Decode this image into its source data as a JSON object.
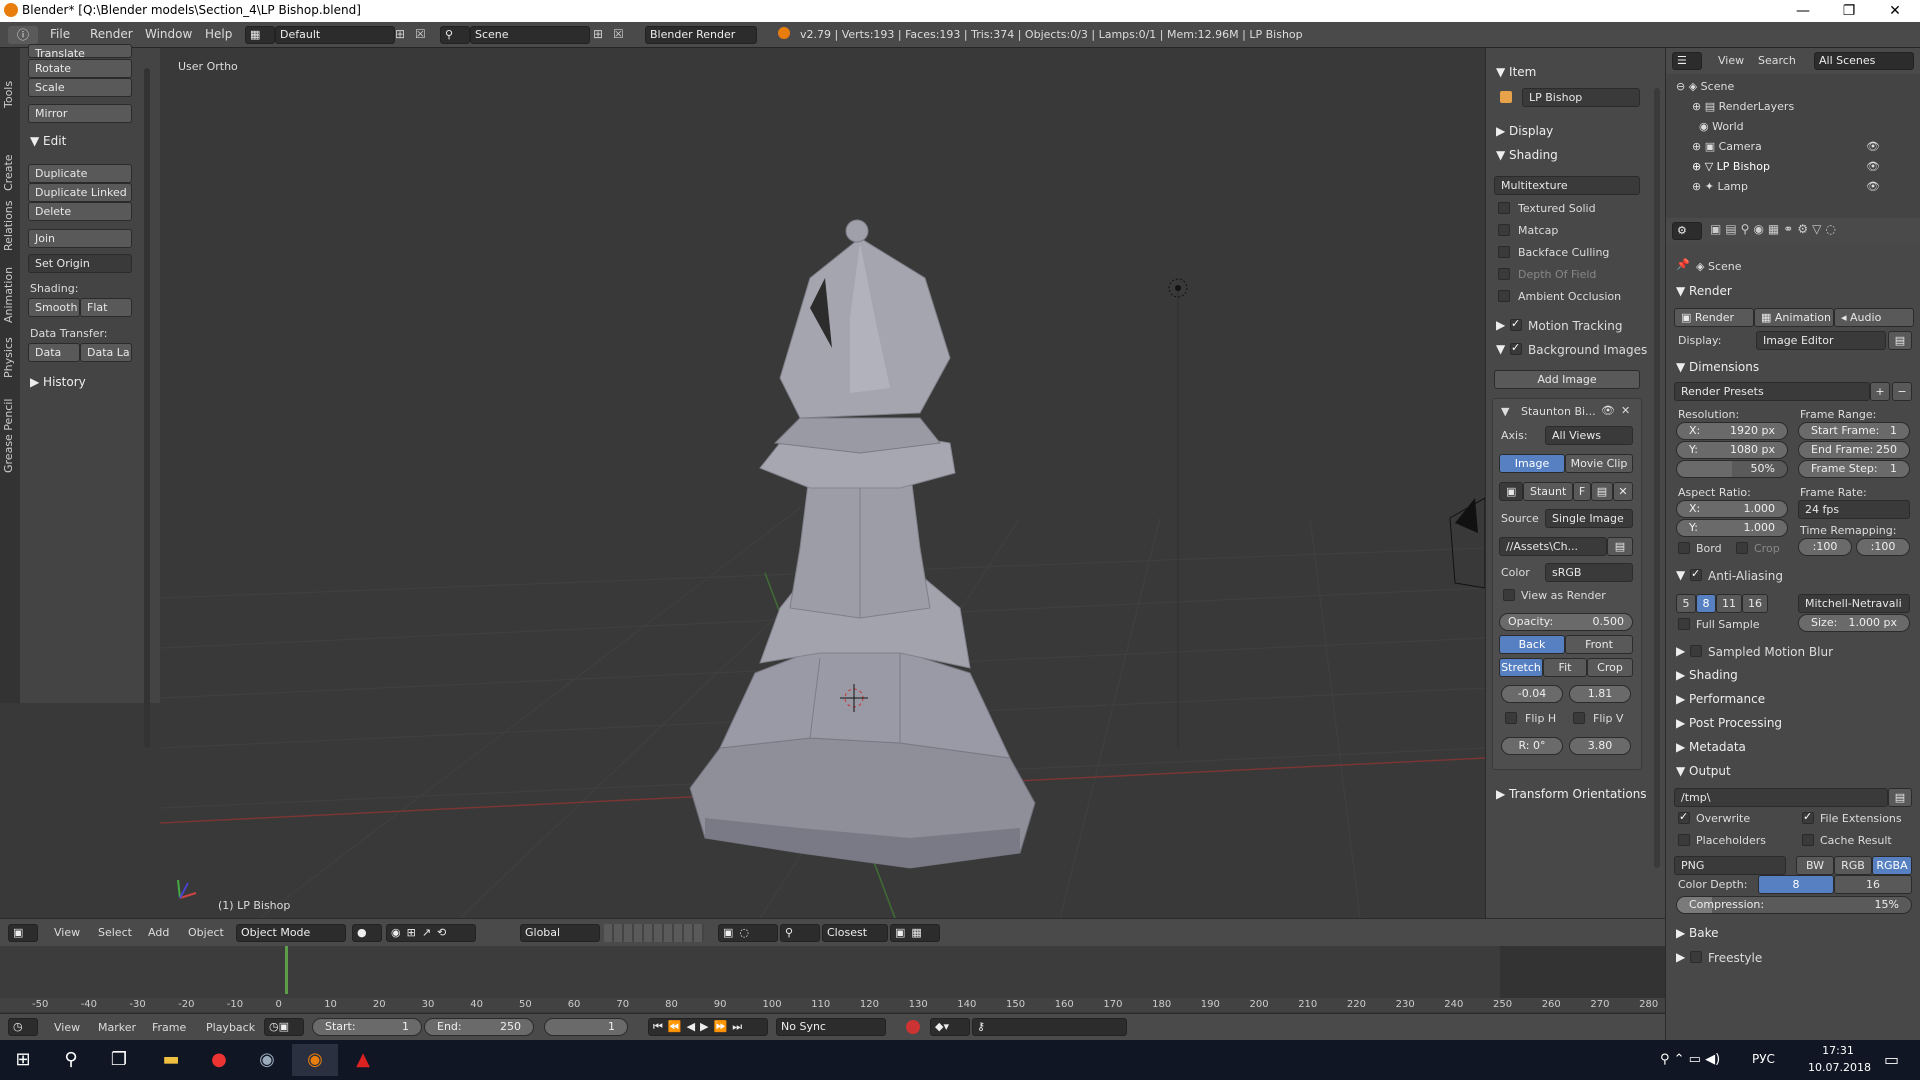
{
  "window": {
    "title": "Blender* [Q:\\Blender models\\Section_4\\LP Bishop.blend]",
    "minimize": "—",
    "maximize": "❐",
    "close": "✕"
  },
  "topbar": {
    "menus": [
      "File",
      "Render",
      "Window",
      "Help"
    ],
    "layout": "Default",
    "scene": "Scene",
    "engine": "Blender Render",
    "stats": "v2.79 | Verts:193 | Faces:193 | Tris:374 | Objects:0/3 | Lamps:0/1 | Mem:12.96M | LP Bishop"
  },
  "tool_tabs": [
    "Tools",
    "Create",
    "Relations",
    "Animation",
    "Physics",
    "Grease Pencil"
  ],
  "tools": {
    "cut": "Translate",
    "rotate": "Rotate",
    "scale": "Scale",
    "mirror": "Mirror",
    "edit_header": "Edit",
    "duplicate": "Duplicate",
    "duplicate_linked": "Duplicate Linked",
    "delete": "Delete",
    "join": "Join",
    "set_origin": "Set Origin",
    "shading_label": "Shading:",
    "smooth": "Smooth",
    "flat": "Flat",
    "data_transfer_label": "Data Transfer:",
    "data": "Data",
    "data_la": "Data La",
    "history": "History"
  },
  "viewport": {
    "view_name": "User Ortho",
    "object_label": "(1) LP Bishop"
  },
  "props": {
    "item_header": "Item",
    "item_name": "LP Bishop",
    "display": "Display",
    "shading": "Shading",
    "shading_mode": "Multitexture",
    "textured_solid": "Textured Solid",
    "matcap": "Matcap",
    "backface": "Backface Culling",
    "dof": "Depth Of Field",
    "ao": "Ambient Occlusion",
    "motion_tracking": "Motion Tracking",
    "bg_images": "Background Images",
    "add_image": "Add Image",
    "bg_name": "Staunton Bi...",
    "axis_label": "Axis:",
    "axis_value": "All Views",
    "image": "Image",
    "movie_clip": "Movie Clip",
    "staunt": "Staunt",
    "f": "F",
    "source_label": "Source",
    "source_value": "Single Image",
    "path": "//Assets\\Ch...",
    "color_label": "Color",
    "color_value": "sRGB",
    "view_as_render": "View as Render",
    "opacity_label": "Opacity:",
    "opacity_value": "0.500",
    "back": "Back",
    "front": "Front",
    "stretch": "Stretch",
    "fit": "Fit",
    "crop": "Crop",
    "x_off": "-0.04",
    "y_off": "1.81",
    "flip_h": "Flip H",
    "flip_v": "Flip V",
    "rotation": "R: 0°",
    "size": "3.80",
    "transform_orient": "Transform Orientations"
  },
  "outliner": {
    "view": "View",
    "search": "Search",
    "all_scenes": "All Scenes",
    "items": [
      {
        "name": "Scene",
        "depth": 0
      },
      {
        "name": "RenderLayers",
        "depth": 1
      },
      {
        "name": "World",
        "depth": 1
      },
      {
        "name": "Camera",
        "depth": 1
      },
      {
        "name": "LP Bishop",
        "depth": 1
      },
      {
        "name": "Lamp",
        "depth": 1
      }
    ]
  },
  "render": {
    "scene": "Scene",
    "render_header": "Render",
    "render_btn": "Render",
    "animation_btn": "Animation",
    "audio_btn": "Audio",
    "display_label": "Display:",
    "display_value": "Image Editor",
    "dimensions": "Dimensions",
    "render_presets": "Render Presets",
    "resolution": "Resolution:",
    "res_x": "X:",
    "res_x_val": "1920 px",
    "res_y": "Y:",
    "res_y_val": "1080 px",
    "res_pct": "50%",
    "frame_range": "Frame Range:",
    "start_frame": "Start Frame:",
    "start_val": "1",
    "end_frame": "End Frame:",
    "end_val": "250",
    "frame_step": "Frame Step:",
    "step_val": "1",
    "aspect": "Aspect Ratio:",
    "asp_x": "X:",
    "asp_x_val": "1.000",
    "asp_y": "Y:",
    "asp_y_val": "1.000",
    "frame_rate": "Frame Rate:",
    "fps": "24 fps",
    "time_remap": "Time Remapping:",
    "remap_old": ":100",
    "remap_new": ":100",
    "bord": "Bord",
    "crop": "Crop",
    "aa": "Anti-Aliasing",
    "aa_levels": [
      "5",
      "8",
      "11",
      "16"
    ],
    "aa_filter": "Mitchell-Netravali",
    "full_sample": "Full Sample",
    "aa_size": "Size:",
    "aa_size_val": "1.000 px",
    "sampled_mb": "Sampled Motion Blur",
    "shading": "Shading",
    "performance": "Performance",
    "post_processing": "Post Processing",
    "metadata": "Metadata",
    "output": "Output",
    "output_path": "/tmp\\",
    "overwrite": "Overwrite",
    "file_ext": "File Extensions",
    "placeholders": "Placeholders",
    "cache_result": "Cache Result",
    "format": "PNG",
    "bw": "BW",
    "rgb": "RGB",
    "rgba": "RGBA",
    "color_depth": "Color Depth:",
    "depth8": "8",
    "depth16": "16",
    "compression": "Compression:",
    "compression_val": "15%",
    "bake": "Bake",
    "freestyle": "Freestyle"
  },
  "viewport_header": {
    "view": "View",
    "select": "Select",
    "add": "Add",
    "object": "Object",
    "mode": "Object Mode",
    "orientation": "Global",
    "snap": "Closest"
  },
  "timeline": {
    "ticks": [
      "-50",
      "-40",
      "-30",
      "-20",
      "-10",
      "0",
      "10",
      "20",
      "30",
      "40",
      "50",
      "60",
      "70",
      "80",
      "90",
      "100",
      "110",
      "120",
      "130",
      "140",
      "150",
      "160",
      "170",
      "180",
      "190",
      "200",
      "210",
      "220",
      "230",
      "240",
      "250",
      "260",
      "270",
      "280"
    ],
    "view": "View",
    "marker": "Marker",
    "frame": "Frame",
    "playback": "Playback",
    "start": "Start:",
    "start_val": "1",
    "end": "End:",
    "end_val": "250",
    "current": "1",
    "sync": "No Sync"
  },
  "taskbar": {
    "lang": "РУС",
    "time": "17:31",
    "date": "10.07.2018"
  }
}
